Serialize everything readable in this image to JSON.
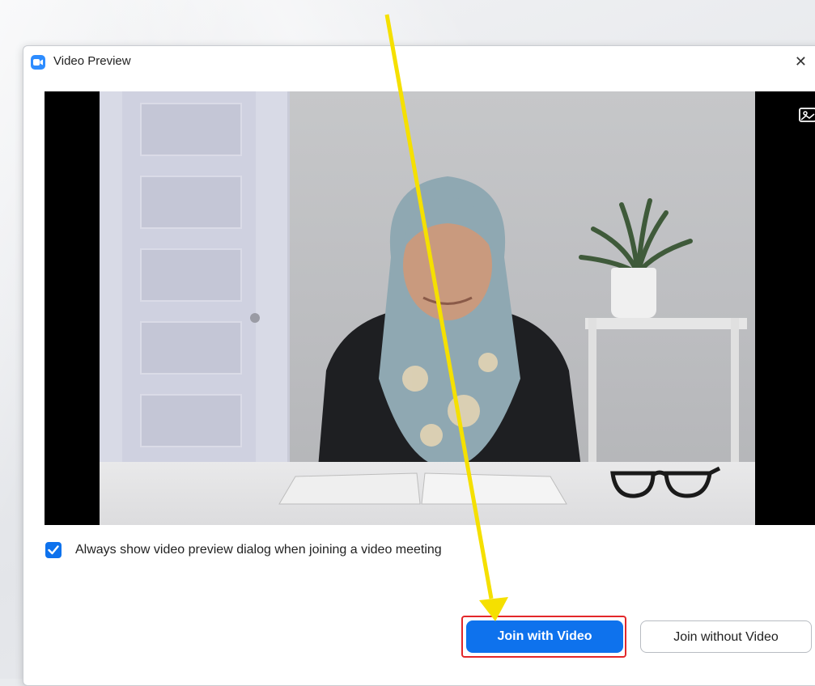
{
  "dialog": {
    "title": "Video Preview",
    "close_glyph": "✕",
    "app_icon": "zoom-camera-icon"
  },
  "video": {
    "background_icon": "change-background-icon"
  },
  "preview_option": {
    "checked": true,
    "label": "Always show video preview dialog when joining a video meeting"
  },
  "buttons": {
    "join_with_video": "Join with Video",
    "join_without_video": "Join without Video"
  },
  "colors": {
    "accent": "#0e72ed",
    "highlight_border": "#e3272a",
    "annotation_arrow": "#f5e000"
  }
}
